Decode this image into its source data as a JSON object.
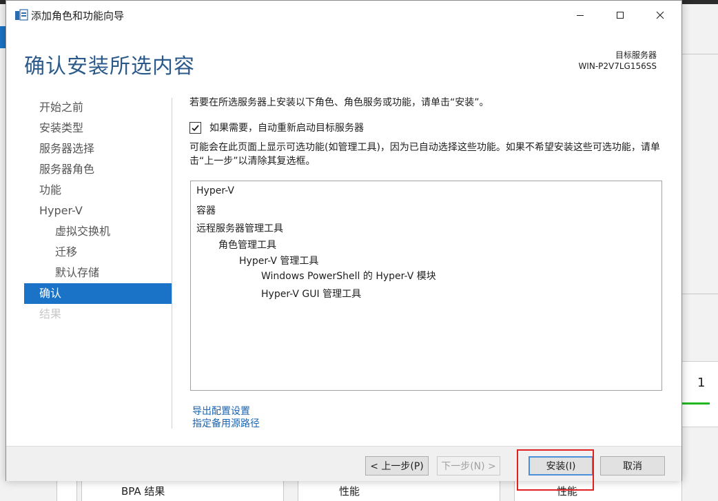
{
  "window": {
    "title": "添加角色和功能向导",
    "minimize_icon": "minimize-icon",
    "maximize_icon": "maximize-icon",
    "close_icon": "close-icon"
  },
  "header": {
    "title": "确认安装所选内容",
    "target_label": "目标服务器",
    "target_value": "WIN-P2V7LG156SS"
  },
  "nav": {
    "items": [
      {
        "label": "开始之前",
        "state": "normal",
        "level": 0
      },
      {
        "label": "安装类型",
        "state": "normal",
        "level": 0
      },
      {
        "label": "服务器选择",
        "state": "normal",
        "level": 0
      },
      {
        "label": "服务器角色",
        "state": "normal",
        "level": 0
      },
      {
        "label": "功能",
        "state": "normal",
        "level": 0
      },
      {
        "label": "Hyper-V",
        "state": "normal",
        "level": 0
      },
      {
        "label": "虚拟交换机",
        "state": "normal",
        "level": 1
      },
      {
        "label": "迁移",
        "state": "normal",
        "level": 1
      },
      {
        "label": "默认存储",
        "state": "normal",
        "level": 1
      },
      {
        "label": "确认",
        "state": "active",
        "level": 0
      },
      {
        "label": "结果",
        "state": "disabled",
        "level": 0
      }
    ]
  },
  "main": {
    "intro": "若要在所选服务器上安装以下角色、角色服务或功能，请单击“安装”。",
    "restart_checkbox": {
      "label": "如果需要，自动重新启动目标服务器",
      "checked": true
    },
    "note": "可能会在此页面上显示可选功能(如管理工具)，因为已自动选择这些功能。如果不希望安装这些可选功能，请单击“上一步”以清除其复选框。",
    "features": [
      {
        "label": "Hyper-V",
        "indent": 0
      },
      {
        "label": "容器",
        "indent": 0
      },
      {
        "label": "远程服务器管理工具",
        "indent": 0
      },
      {
        "label": "角色管理工具",
        "indent": 1
      },
      {
        "label": "Hyper-V 管理工具",
        "indent": 2
      },
      {
        "label": "Windows PowerShell 的 Hyper-V 模块",
        "indent": 3
      },
      {
        "label": "Hyper-V GUI 管理工具",
        "indent": 3
      }
    ],
    "export_link": "导出配置设置",
    "alt_source_link": "指定备用源路径"
  },
  "buttons": {
    "previous": "< 上一步(P)",
    "next": "下一步(N) >",
    "install": "安装(I)",
    "cancel": "取消"
  },
  "background": {
    "tile_count": "1",
    "col1": "BPA 结果",
    "col2": "性能",
    "col3": "性能"
  },
  "colors": {
    "accent": "#1a73c7",
    "title": "#2b5a8a",
    "link": "#1a63b0",
    "highlight": "#e02020"
  }
}
